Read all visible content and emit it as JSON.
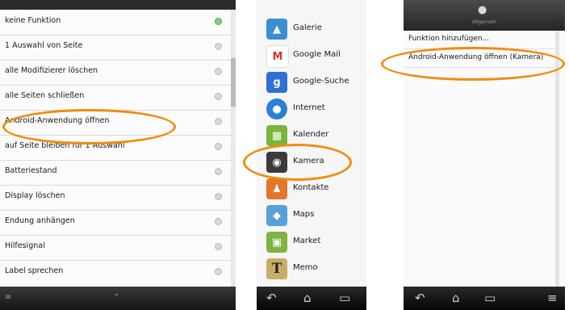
{
  "accent_color": "#f08c0d",
  "function_list": {
    "items": [
      {
        "label": "keine Funktion",
        "selected": true
      },
      {
        "label": "1 Auswahl von Seite",
        "selected": false
      },
      {
        "label": "alle Modifizierer löschen",
        "selected": false
      },
      {
        "label": "alle Seiten schließen",
        "selected": false
      },
      {
        "label": "Android-Anwendung öffnen",
        "selected": false
      },
      {
        "label": "auf Seite bleiben für 1 Auswahl",
        "selected": false
      },
      {
        "label": "Batteriestand",
        "selected": false
      },
      {
        "label": "Display löschen",
        "selected": false
      },
      {
        "label": "Endung anhängen",
        "selected": false
      },
      {
        "label": "Hilfesignal",
        "selected": false
      },
      {
        "label": "Label sprechen",
        "selected": false
      }
    ],
    "bottom_left_glyph": "≡",
    "bottom_center_glyph": "⌃"
  },
  "app_list": {
    "items": [
      {
        "name": "Galerie",
        "icon": "gallery-icon",
        "glyph": "▲",
        "color": "#3a8fd0"
      },
      {
        "name": "Google Mail",
        "icon": "gmail-icon",
        "glyph": "M",
        "color": "#d8332a"
      },
      {
        "name": "Google-Suche",
        "icon": "google-search-icon",
        "glyph": "g",
        "color": "#2f6fd6"
      },
      {
        "name": "Internet",
        "icon": "globe-icon",
        "glyph": "●",
        "color": "#2d7ed8"
      },
      {
        "name": "Kalender",
        "icon": "calendar-icon",
        "glyph": "▦",
        "color": "#7bb43a"
      },
      {
        "name": "Kamera",
        "icon": "camera-icon",
        "glyph": "◉",
        "color": "#3a3a3a"
      },
      {
        "name": "Kontakte",
        "icon": "contacts-icon",
        "glyph": "♟",
        "color": "#e3762a"
      },
      {
        "name": "Maps",
        "icon": "maps-icon",
        "glyph": "◆",
        "color": "#58a0d8"
      },
      {
        "name": "Market",
        "icon": "market-icon",
        "glyph": "▣",
        "color": "#7fb342"
      },
      {
        "name": "Memo",
        "icon": "memo-icon",
        "glyph": "T",
        "color": "#c8ad6a"
      }
    ],
    "nav": {
      "back": "↶",
      "home": "⌂",
      "recent": "▭"
    }
  },
  "summary_panel": {
    "header_caption": "Allgemein",
    "header_icon": "speech-icon",
    "rows": [
      "Funktion hinzufügen...",
      "Android-Anwendung öffnen (Kamera)"
    ],
    "nav": {
      "back": "↶",
      "home": "⌂",
      "recent": "▭",
      "menu": "≡"
    }
  }
}
